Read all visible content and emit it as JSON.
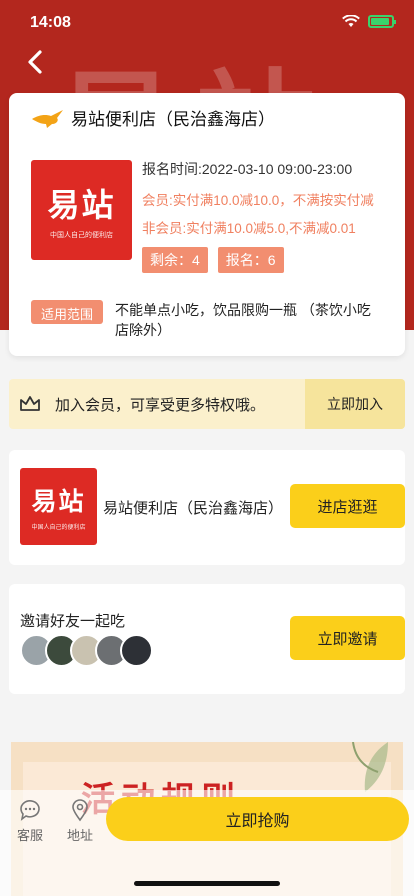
{
  "status": {
    "time": "14:08"
  },
  "hero": {
    "bg_text": "易站"
  },
  "store": {
    "title": "易站便利店（民治鑫海店）",
    "logo_main": "易站",
    "logo_sub": "中国人自己的便利店",
    "reg_time": "报名时间:2022-03-10 09:00-23:00",
    "rule_member": "会员:实付满10.0减10.0，不满按实付减",
    "rule_nonmember": "非会员:实付满10.0减5.0,不满减0.01",
    "remaining": "剩余：4",
    "registered": "报名：6",
    "scope_tag": "适用范围",
    "scope_text": "不能单点小吃，饮品限购一瓶 （茶饮小吃店除外）"
  },
  "member": {
    "text": "加入会员，可享受更多特权哦。",
    "join_label": "立即加入"
  },
  "store_card": {
    "name": "易站便利店（民治鑫海店）",
    "visit_label": "进店逛逛"
  },
  "invite": {
    "title": "邀请好友一起吃",
    "invite_label": "立即邀请",
    "avatars": [
      "#9aa3a8",
      "#3c4a3c",
      "#c9c2b0",
      "#6c6f72",
      "#2d3036"
    ]
  },
  "promo": {
    "title": "活动规则"
  },
  "bottom": {
    "service_label": "客服",
    "address_label": "地址",
    "buy_label": "立即抢购"
  },
  "colors": {
    "hero": "#b3271e",
    "accent": "#fbcf1a",
    "badge": "#f28e70",
    "logo": "#dd2a24"
  }
}
